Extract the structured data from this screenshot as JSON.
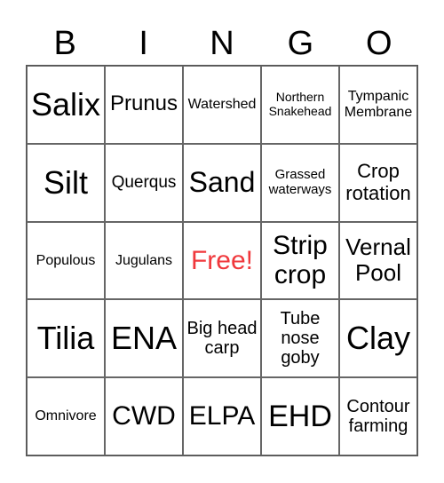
{
  "header": [
    "B",
    "I",
    "N",
    "G",
    "O"
  ],
  "colors": {
    "free": "#f0383c"
  },
  "cells": [
    {
      "text": "Salix",
      "size": 36
    },
    {
      "text": "Prunus",
      "size": 24
    },
    {
      "text": "Watershed",
      "size": 16
    },
    {
      "text": "Northern Snakehead",
      "size": 14
    },
    {
      "text": "Tympanic Membrane",
      "size": 16
    },
    {
      "text": "Silt",
      "size": 36
    },
    {
      "text": "Querqus",
      "size": 19
    },
    {
      "text": "Sand",
      "size": 32
    },
    {
      "text": "Grassed waterways",
      "size": 15
    },
    {
      "text": "Crop rotation",
      "size": 22
    },
    {
      "text": "Populous",
      "size": 16
    },
    {
      "text": "Jugulans",
      "size": 16
    },
    {
      "text": "Free!",
      "size": 30,
      "free": true
    },
    {
      "text": "Strip crop",
      "size": 30
    },
    {
      "text": "Vernal Pool",
      "size": 26
    },
    {
      "text": "Tilia",
      "size": 36
    },
    {
      "text": "ENA",
      "size": 36
    },
    {
      "text": "Big head carp",
      "size": 20
    },
    {
      "text": "Tube nose goby",
      "size": 20
    },
    {
      "text": "Clay",
      "size": 36
    },
    {
      "text": "Omnivore",
      "size": 16
    },
    {
      "text": "CWD",
      "size": 30
    },
    {
      "text": "ELPA",
      "size": 30
    },
    {
      "text": "EHD",
      "size": 34
    },
    {
      "text": "Contour farming",
      "size": 20
    }
  ]
}
